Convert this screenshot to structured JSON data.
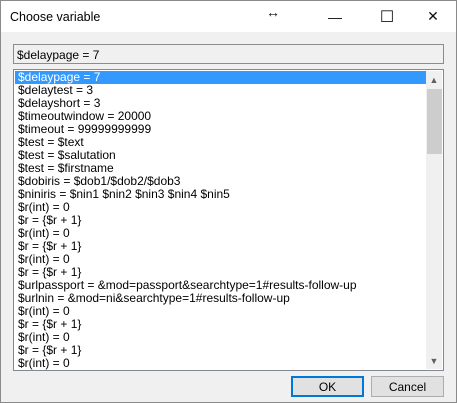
{
  "window": {
    "title": "Choose variable"
  },
  "selected_value": "$delaypage = 7",
  "list": {
    "items": [
      "$delaypage = 7",
      "$delaytest = 3",
      "$delayshort = 3",
      "$timeoutwindow = 20000",
      "$timeout = 99999999999",
      "$test = $text",
      "$test = $salutation",
      "$test = $firstname",
      "$dobiris = $dob1/$dob2/$dob3",
      "$niniris = $nin1 $nin2 $nin3 $nin4 $nin5",
      "$r(int) = 0",
      "$r = {$r + 1}",
      "$r(int) = 0",
      "$r = {$r + 1}",
      "$r(int) = 0",
      "$r = {$r + 1}",
      "$urlpassport = &mod=passport&searchtype=1#results-follow-up",
      "$urlnin = &mod=ni&searchtype=1#results-follow-up",
      "$r(int) = 0",
      "$r = {$r + 1}",
      "$r(int) = 0",
      "$r = {$r + 1}",
      "$r(int) = 0"
    ],
    "selected_index": 0
  },
  "buttons": {
    "ok": "OK",
    "cancel": "Cancel"
  },
  "icons": {
    "resize": "↔",
    "minimize": "—",
    "maximize": "☐",
    "close": "✕",
    "up": "▲",
    "down": "▼"
  }
}
